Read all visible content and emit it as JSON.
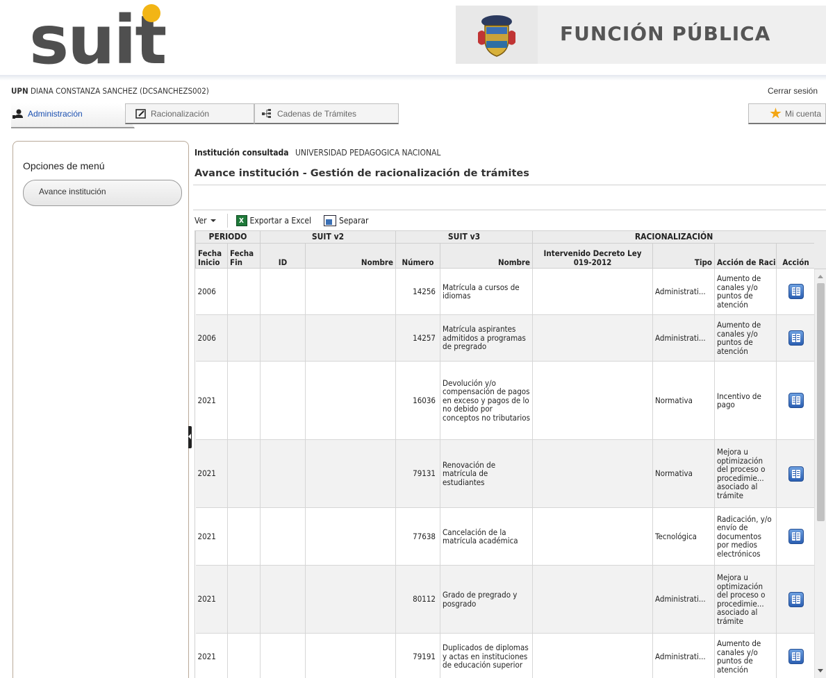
{
  "header": {
    "logo_text": "suit",
    "banner_text": "FUNCIÓN PÚBLICA"
  },
  "user": {
    "org": "UPN",
    "name": "DIANA CONSTANZA SANCHEZ (DCSANCHEZS002)",
    "logout_label": "Cerrar sesión"
  },
  "tabs": {
    "admin": "Administración",
    "racionalizacion": "Racionalización",
    "cadenas": "Cadenas de Trámites",
    "cuenta": "Mi cuenta"
  },
  "sidebar": {
    "title": "Opciones de menú",
    "items": [
      {
        "label": "Avance institución"
      }
    ]
  },
  "main": {
    "institution_label": "Institución consultada",
    "institution_value": "UNIVERSIDAD PEDAGOGICA NACIONAL",
    "title": "Avance institución - Gestión de racionalización de trámites"
  },
  "toolbar": {
    "view_label": "Ver",
    "excel_label": "Exportar a Excel",
    "split_label": "Separar"
  },
  "table": {
    "groups": {
      "periodo": "PERIODO",
      "suit_v2": "SUIT v2",
      "suit_v3": "SUIT v3",
      "racionalizacion": "RACIONALIZACIÓN"
    },
    "columns": {
      "fecha_inicio": "Fecha Inicio",
      "fecha_fin": "Fecha Fin",
      "id": "ID",
      "nombre_v2": "Nombre",
      "numero": "Número",
      "nombre_v3": "Nombre",
      "intervenido": "Intervenido Decreto Ley 019-2012",
      "tipo": "Tipo",
      "accion_rac": "Acción de Racionalizac",
      "accion": "Acción"
    },
    "rows": [
      {
        "inicio": "2006",
        "fin": "",
        "id": "",
        "nombre_v2": "",
        "numero": "14256",
        "nombre_v3": "Matrícula a cursos de idiomas",
        "intervenido": "",
        "tipo": "Administrati...",
        "accion_rac": "Aumento de canales y/o puntos de atención"
      },
      {
        "inicio": "2006",
        "fin": "",
        "id": "",
        "nombre_v2": "",
        "numero": "14257",
        "nombre_v3": "Matrícula aspirantes admitidos a programas de pregrado",
        "intervenido": "",
        "tipo": "Administrati...",
        "accion_rac": "Aumento de canales y/o puntos de atención"
      },
      {
        "inicio": "2021",
        "fin": "",
        "id": "",
        "nombre_v2": "",
        "numero": "16036",
        "nombre_v3": "Devolución y/o compensación de pagos en exceso y pagos de lo no debido por conceptos no tributarios",
        "intervenido": "",
        "tipo": "Normativa",
        "accion_rac": "Incentivo de pago"
      },
      {
        "inicio": "2021",
        "fin": "",
        "id": "",
        "nombre_v2": "",
        "numero": "79131",
        "nombre_v3": "Renovación de matrícula de estudiantes",
        "intervenido": "",
        "tipo": "Normativa",
        "accion_rac": "Mejora u optimización del proceso o procedimie... asociado al trámite"
      },
      {
        "inicio": "2021",
        "fin": "",
        "id": "",
        "nombre_v2": "",
        "numero": "77638",
        "nombre_v3": "Cancelación de la matrícula académica",
        "intervenido": "",
        "tipo": "Tecnológica",
        "accion_rac": "Radicación, y/o envío de documentos por medios electrónicos"
      },
      {
        "inicio": "2021",
        "fin": "",
        "id": "",
        "nombre_v2": "",
        "numero": "80112",
        "nombre_v3": "Grado de pregrado y posgrado",
        "intervenido": "",
        "tipo": "Administrati...",
        "accion_rac": "Mejora u optimización del proceso o procedimie... asociado al trámite"
      },
      {
        "inicio": "2021",
        "fin": "",
        "id": "",
        "nombre_v2": "",
        "numero": "79191",
        "nombre_v3": "Duplicados de diplomas y actas en instituciones de educación superior",
        "intervenido": "",
        "tipo": "Administrati...",
        "accion_rac": "Aumento de canales y/o puntos de atención"
      }
    ]
  },
  "colors": {
    "brand_yellow": "#f2b515",
    "link_blue": "#1a4fb0",
    "header_gray": "#ececec"
  }
}
